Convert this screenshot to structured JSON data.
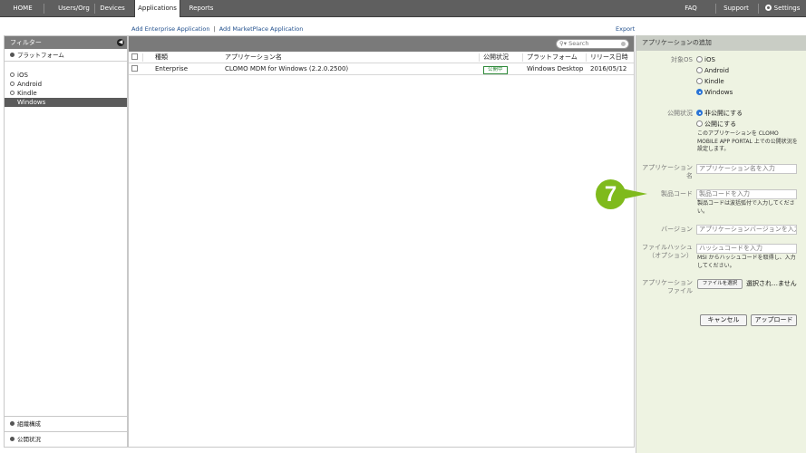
{
  "nav": {
    "items": [
      "HOME",
      "Users/Org",
      "Devices",
      "Applications",
      "Reports"
    ],
    "active": "Applications",
    "faq": "FAQ",
    "support": "Support",
    "settings": "Settings"
  },
  "sublinks": {
    "add_enterprise": "Add Enterprise Application",
    "separator": "|",
    "add_marketplace": "Add MarketPlace Application",
    "export": "Export"
  },
  "filter": {
    "title": "フィルター",
    "platform_section": "プラットフォーム",
    "platforms": [
      "iOS",
      "Android",
      "Kindle",
      "Windows"
    ],
    "selected_platform": "Windows",
    "org_section": "組織構成",
    "status_section": "公開状況"
  },
  "table": {
    "search_placeholder": "Search",
    "headers": [
      "種類",
      "アプリケーション名",
      "公開状況",
      "プラットフォーム",
      "リリース日時"
    ],
    "rows": [
      {
        "type": "Enterprise",
        "name": "CLOMO MDM for Windows (2.2.0.2500)",
        "status": "公開中",
        "platform": "Windows Desktop",
        "release": "2016/05/12"
      }
    ]
  },
  "add_panel": {
    "title": "アプリケーションの追加",
    "target_os_label": "対象OS",
    "os_options": [
      "iOS",
      "Android",
      "Kindle",
      "Windows"
    ],
    "os_selected": "Windows",
    "publish_label": "公開状況",
    "publish_options": [
      "非公開にする",
      "公開にする"
    ],
    "publish_selected": "非公開にする",
    "publish_note": "このアプリケーションを CLOMO MOBILE APP PORTAL 上での公開状況を設定します。",
    "app_name_label": "アプリケーション名",
    "app_name_placeholder": "アプリケーション名を入力",
    "product_code_label": "製品コード",
    "product_code_placeholder": "製品コードを入力",
    "product_code_note": "製品コードは波括弧付で入力してください。",
    "version_label": "バージョン",
    "version_placeholder": "アプリケーションバージョンを入力",
    "hash_label": "ファイルハッシュ（オプション）",
    "hash_placeholder": "ハッシュコードを入力",
    "hash_note": "MSI からハッシュコードを取得し、入力してください。",
    "file_label": "アプリケーションファイル",
    "file_button": "ファイルを選択",
    "file_status": "選択され…ません",
    "cancel": "キャンセル",
    "upload": "アップロード"
  },
  "callout": "7",
  "colors": {
    "nav_bg": "#5f5f5f",
    "panel_bg": "#eef3e2",
    "callout": "#7fba1c",
    "status_green": "#2f8a3a",
    "link_blue": "#1f4e8c"
  }
}
